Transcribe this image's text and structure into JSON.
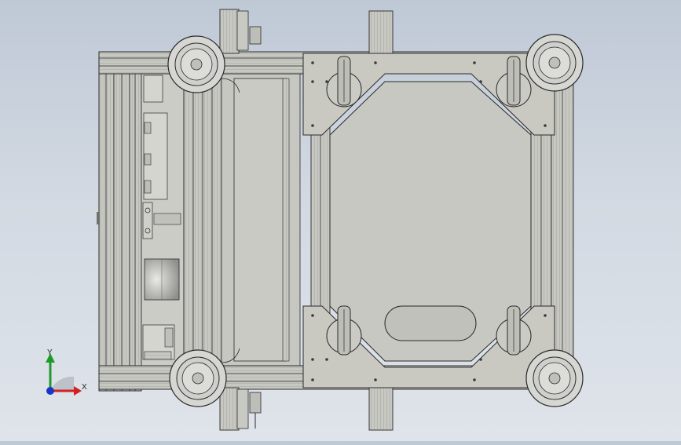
{
  "viewport": {
    "background_top": "#bfc9d6",
    "background_bottom": "#dfe4ea",
    "model_fill": "#c4c5bf",
    "model_stroke": "#2a2a2a",
    "plate_fill": "#c9c9c2",
    "wheel_fill": "#d6d6d2"
  },
  "triad": {
    "x_label": "X",
    "y_label": "Y",
    "x_color": "#d42020",
    "y_color": "#1f9a2a",
    "z_color": "#1a34c8"
  }
}
